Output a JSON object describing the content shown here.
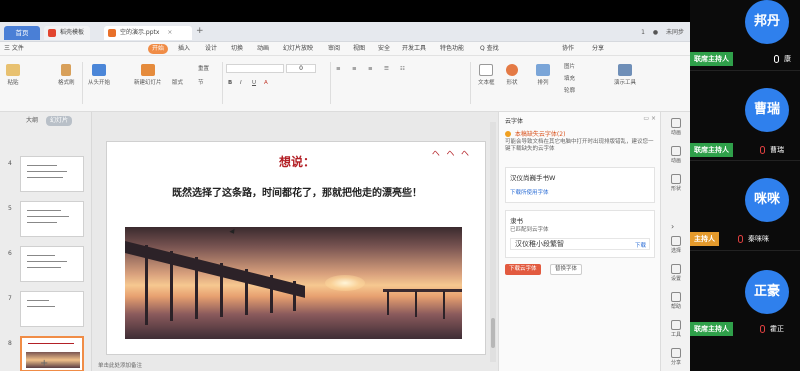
{
  "window": {
    "home_tab": "首页",
    "tabs": [
      {
        "label": "稻壳模板"
      },
      {
        "label": "空的演示.pptx"
      }
    ],
    "right_status": [
      "1",
      "未同步"
    ]
  },
  "menu": {
    "items": [
      "三 文件",
      "开始",
      "插入",
      "设计",
      "切换",
      "动画",
      "幻灯片放映",
      "审阅",
      "视图",
      "安全",
      "开发工具",
      "特色功能",
      "Q 查找"
    ],
    "active": "开始",
    "right": [
      "协作",
      "分享"
    ]
  },
  "ribbon": {
    "paste": "粘贴",
    "format_painter": "格式刷",
    "from_start": "从头开始",
    "new_slide": "新建幻灯片",
    "layout": "版式",
    "section": "节",
    "reset": "重置",
    "font_size": "0",
    "text_box": "文本框",
    "shape": "形状",
    "arrange": "排列",
    "picture": "图片",
    "fill": "填充",
    "outline": "轮廓",
    "presentation_tools": "演示工具"
  },
  "left_panel": {
    "tabs": [
      "大纲",
      "幻灯片"
    ],
    "slide_numbers": [
      "4",
      "5",
      "6",
      "7",
      "8"
    ],
    "add": "+"
  },
  "slide": {
    "title": "想说：",
    "body": "既然选择了这条路，时间都花了，那就把他走的漂亮些！",
    "decoration": "ヘ ヘ ヘ"
  },
  "status_bar": {
    "note": "单击此处添加备注"
  },
  "cloud_font_panel": {
    "header": "云字体",
    "warning": "本稿缺失云字体(2)",
    "description": "可能会导致文档在其它电脑中打开时出现排版错乱，建议您一键下载缺失的云字体",
    "cards": [
      {
        "title": "汉仪尚巍手书W",
        "link": "下载所使用字体"
      },
      {
        "title": "隶书",
        "link": "已匹配到云字体",
        "sample": "汉仪稚小段繁智",
        "download": "下载"
      }
    ],
    "primary_button": "下载云字体",
    "secondary_button": "替换字体"
  },
  "right_tools": [
    "动画",
    "动画",
    "形状",
    "选择",
    "设置",
    "帮助",
    "工具",
    "分享"
  ],
  "participants": [
    {
      "avatar": "邦丹",
      "role": "联席主持人",
      "name": "康",
      "role_color": "green"
    },
    {
      "avatar": "曹瑞",
      "role": "联席主持人",
      "name": "曹瑞",
      "role_color": "green"
    },
    {
      "avatar": "咪咪",
      "role": "主持人",
      "name": "秦咪咪",
      "role_color": "orange"
    },
    {
      "avatar": "正豪",
      "role": "联席主持人",
      "name": "霍正",
      "role_color": "green"
    }
  ],
  "colors": {
    "accent_orange": "#f08c46",
    "title_red": "#b32026",
    "avatar_blue": "#2f80ed",
    "cohost_green": "#2fa04a",
    "host_orange": "#e49a2c"
  }
}
